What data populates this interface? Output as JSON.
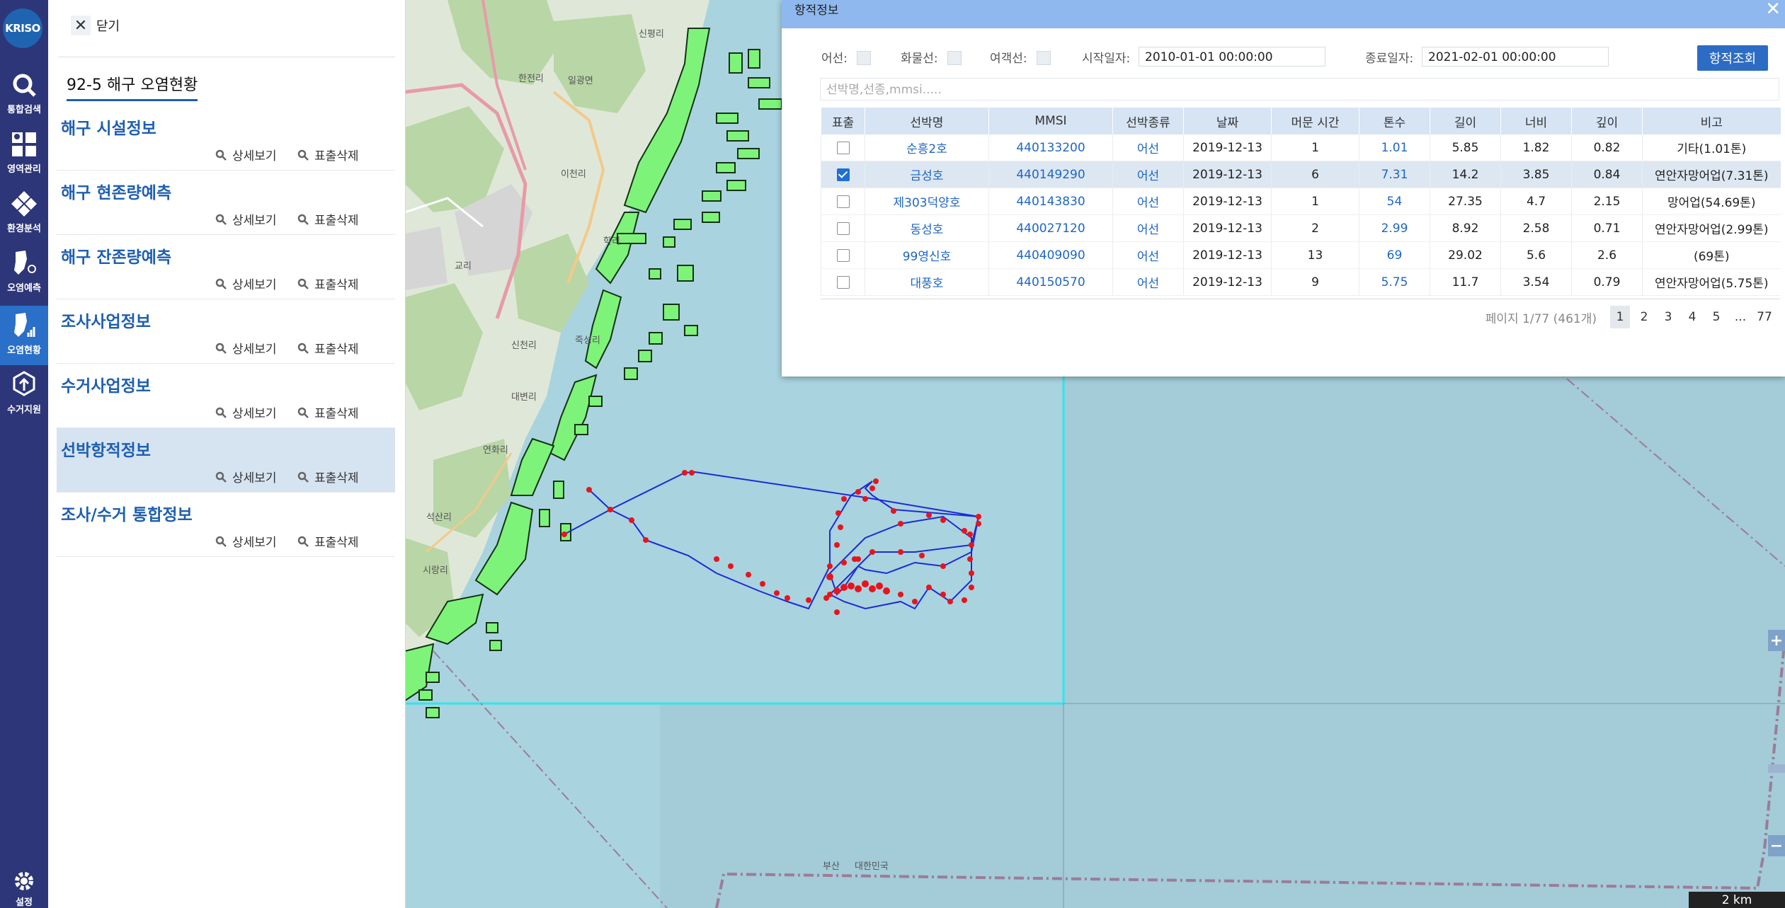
{
  "rail": {
    "logo": "KRISO",
    "items": [
      {
        "label": "통합검색",
        "icon": "search-icon"
      },
      {
        "label": "영역관리",
        "icon": "area-icon"
      },
      {
        "label": "환경분석",
        "icon": "diamond-grid-icon"
      },
      {
        "label": "오염예측",
        "icon": "forecast-map-icon"
      },
      {
        "label": "오염현황",
        "icon": "pollution-map-icon"
      },
      {
        "label": "수거지원",
        "icon": "recycle-icon"
      }
    ],
    "settings_label": "설정",
    "active_index": 4,
    "colors": {
      "background": "#2d3678",
      "active": "#2a6fc8"
    }
  },
  "panel": {
    "close_label": "닫기",
    "title": "92-5 해구 오염현황",
    "detail_label": "상세보기",
    "remove_label": "표출삭제",
    "items": [
      {
        "label": "해구 시설정보"
      },
      {
        "label": "해구 현존량예측"
      },
      {
        "label": "해구 잔존량예측"
      },
      {
        "label": "조사사업정보"
      },
      {
        "label": "수거사업정보"
      },
      {
        "label": "선박항적정보",
        "selected": true
      },
      {
        "label": "조사/수거 통합정보"
      }
    ]
  },
  "popup": {
    "title": "항적정보",
    "filters": {
      "fishing_label": "어선:",
      "cargo_label": "화물선:",
      "passenger_label": "여객선:",
      "start_label": "시작일자:",
      "start_value": "2010-01-01 00:00:00",
      "end_label": "종료일자:",
      "end_value": "2021-02-01 00:00:00",
      "search_button": "항적조회",
      "keyword_placeholder": "선박명,선종,mmsi....."
    },
    "columns": [
      "표출",
      "선박명",
      "MMSI",
      "선박종류",
      "날짜",
      "머문 시간",
      "톤수",
      "길이",
      "너비",
      "깊이",
      "비고"
    ],
    "rows": [
      {
        "checked": false,
        "name": "순흥2호",
        "mmsi": "440133200",
        "type": "어선",
        "date": "2019-12-13",
        "stay": "1",
        "ton": "1.01",
        "length": "5.85",
        "width": "1.82",
        "depth": "0.82",
        "note": "기타(1.01톤)"
      },
      {
        "checked": true,
        "name": "금성호",
        "mmsi": "440149290",
        "type": "어선",
        "date": "2019-12-13",
        "stay": "6",
        "ton": "7.31",
        "length": "14.2",
        "width": "3.85",
        "depth": "0.84",
        "note": "연안자망어업(7.31톤)"
      },
      {
        "checked": false,
        "name": "제303덕양호",
        "mmsi": "440143830",
        "type": "어선",
        "date": "2019-12-13",
        "stay": "1",
        "ton": "54",
        "length": "27.35",
        "width": "4.7",
        "depth": "2.15",
        "note": "망어업(54.69톤)"
      },
      {
        "checked": false,
        "name": "동성호",
        "mmsi": "440027120",
        "type": "어선",
        "date": "2019-12-13",
        "stay": "2",
        "ton": "2.99",
        "length": "8.92",
        "width": "2.58",
        "depth": "0.71",
        "note": "연안자망어업(2.99톤)"
      },
      {
        "checked": false,
        "name": "99영신호",
        "mmsi": "440409090",
        "type": "어선",
        "date": "2019-12-13",
        "stay": "13",
        "ton": "69",
        "length": "29.02",
        "width": "5.6",
        "depth": "2.6",
        "note": "(69톤)"
      },
      {
        "checked": false,
        "name": "대풍호",
        "mmsi": "440150570",
        "type": "어선",
        "date": "2019-12-13",
        "stay": "9",
        "ton": "5.75",
        "length": "11.7",
        "width": "3.54",
        "depth": "0.79",
        "note": "연안자망어업(5.75톤)"
      }
    ],
    "pager": {
      "info": "페이지 1/77 (461개)",
      "pages": [
        "1",
        "2",
        "3",
        "4",
        "5",
        "...",
        "77"
      ],
      "current": "1"
    }
  },
  "map": {
    "scale_label": "2 km",
    "labels": [
      {
        "text": "한전리"
      },
      {
        "text": "일광면"
      },
      {
        "text": "신평리"
      },
      {
        "text": "이천리"
      },
      {
        "text": "학리"
      },
      {
        "text": "교리"
      },
      {
        "text": "신천리"
      },
      {
        "text": "죽성리"
      },
      {
        "text": "대변리"
      },
      {
        "text": "연화리"
      },
      {
        "text": "석산리"
      },
      {
        "text": "시랑리"
      },
      {
        "text": "부산"
      },
      {
        "text": "대한민국"
      }
    ],
    "colors": {
      "sea": "#a9d3df",
      "land": "#dfe8d8",
      "forest": "#b9d6a6",
      "farms": "#7ef37a",
      "track": "#1c2bd6",
      "points": "#e8141c",
      "boundary": "#30e6e9"
    }
  }
}
